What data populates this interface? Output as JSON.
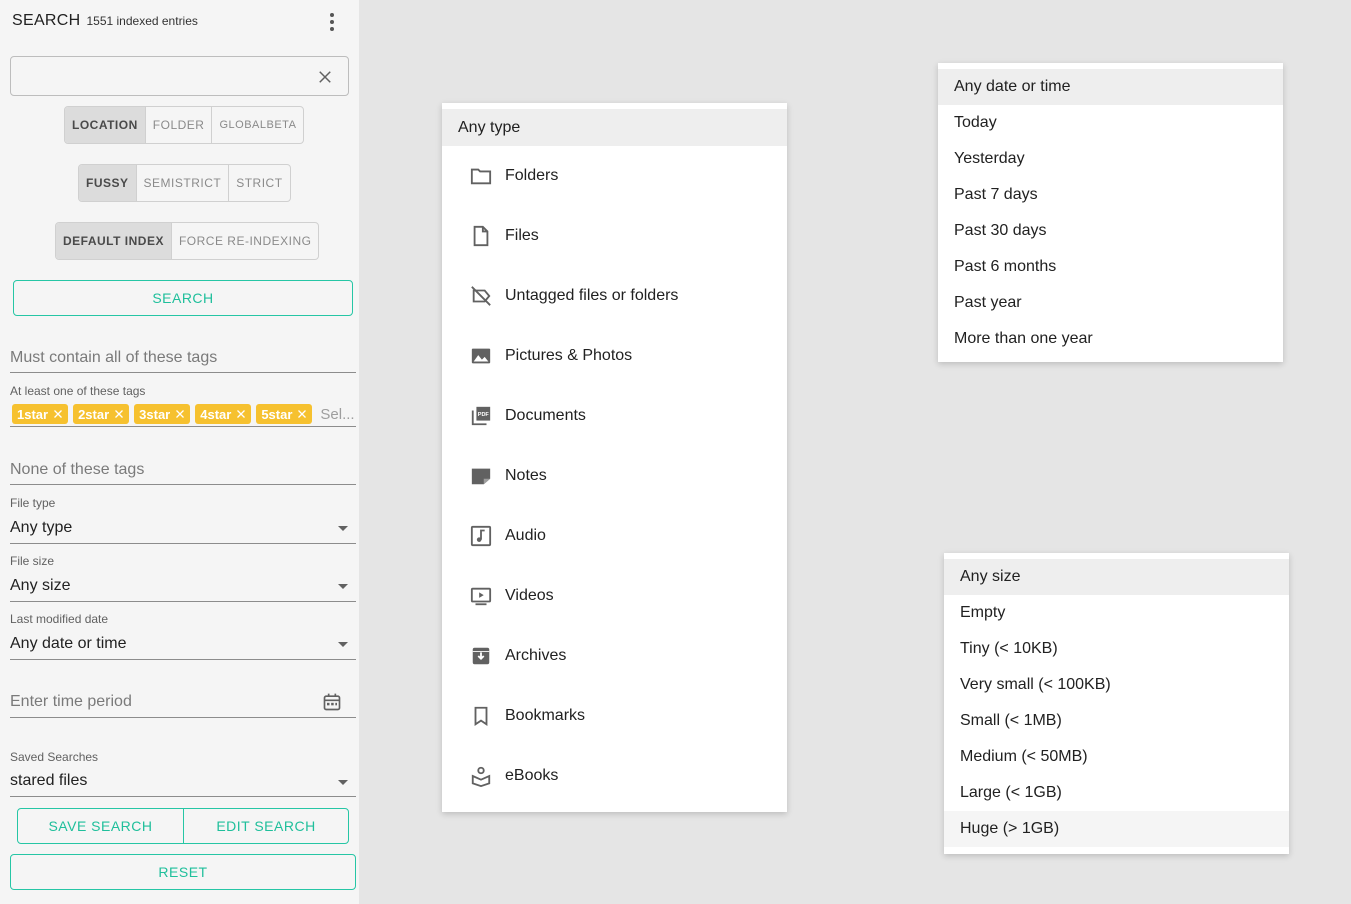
{
  "header": {
    "title": "SEARCH",
    "count": "1551 indexed entries"
  },
  "search": {
    "value": ""
  },
  "location_group": [
    "LOCATION",
    "FOLDER",
    "GLOBALBETA"
  ],
  "match_group": [
    "FUSSY",
    "SEMISTRICT",
    "STRICT"
  ],
  "index_group": [
    "DEFAULT INDEX",
    "FORCE RE-INDEXING"
  ],
  "search_button": "SEARCH",
  "must_tags": {
    "placeholder": "Must contain all of these tags"
  },
  "any_tags": {
    "label": "At least one of these tags",
    "chips": [
      "1star",
      "2star",
      "3star",
      "4star",
      "5star"
    ],
    "placeholder": "Sel..."
  },
  "none_tags": {
    "placeholder": "None of these tags"
  },
  "file_type": {
    "label": "File type",
    "value": "Any type"
  },
  "file_size": {
    "label": "File size",
    "value": "Any size"
  },
  "modified": {
    "label": "Last modified date",
    "value": "Any date or time"
  },
  "time_period": {
    "placeholder": "Enter time period"
  },
  "saved": {
    "label": "Saved Searches",
    "value": "stared files"
  },
  "save_button": "SAVE SEARCH",
  "edit_button": "EDIT SEARCH",
  "reset_button": "RESET",
  "type_menu": {
    "selected": "Any type",
    "items": [
      {
        "label": "Folders",
        "icon": "folder-icon"
      },
      {
        "label": "Files",
        "icon": "file-icon"
      },
      {
        "label": "Untagged files or folders",
        "icon": "untagged-icon"
      },
      {
        "label": "Pictures & Photos",
        "icon": "image-icon"
      },
      {
        "label": "Documents",
        "icon": "pdf-icon"
      },
      {
        "label": "Notes",
        "icon": "note-icon"
      },
      {
        "label": "Audio",
        "icon": "music-icon"
      },
      {
        "label": "Videos",
        "icon": "video-icon"
      },
      {
        "label": "Archives",
        "icon": "archive-icon"
      },
      {
        "label": "Bookmarks",
        "icon": "bookmark-icon"
      },
      {
        "label": "eBooks",
        "icon": "book-icon"
      }
    ]
  },
  "date_menu": [
    "Any date or time",
    "Today",
    "Yesterday",
    "Past 7 days",
    "Past 30 days",
    "Past 6 months",
    "Past year",
    "More than one year"
  ],
  "size_menu": [
    "Any size",
    "Empty",
    "Tiny (< 10KB)",
    "Very small (< 100KB)",
    "Small (< 1MB)",
    "Medium (< 50MB)",
    "Large (< 1GB)",
    "Huge (> 1GB)"
  ],
  "colors": {
    "accent": "#1fbf9b",
    "chip": "#f6c12f",
    "icon": "#616161"
  }
}
